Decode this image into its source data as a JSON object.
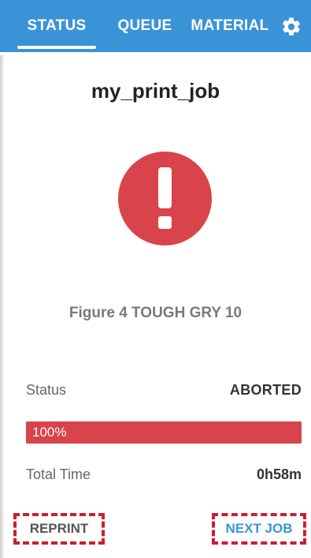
{
  "tabs": {
    "status": "STATUS",
    "queue": "QUEUE",
    "material": "MATERIAL"
  },
  "job": {
    "name": "my_print_job",
    "material": "Figure 4 TOUGH GRY 10"
  },
  "status": {
    "label": "Status",
    "value": "ABORTED",
    "progress_text": "100%",
    "progress_fraction": 1.0
  },
  "time": {
    "label": "Total Time",
    "value": "0h58m"
  },
  "actions": {
    "reprint": "REPRINT",
    "next_job": "NEXT JOB"
  },
  "colors": {
    "header": "#3a93d6",
    "alert": "#d9434c",
    "highlight_dash": "#c8202f"
  },
  "icons": {
    "settings": "gear-icon",
    "alert": "exclamation-alert-icon"
  }
}
